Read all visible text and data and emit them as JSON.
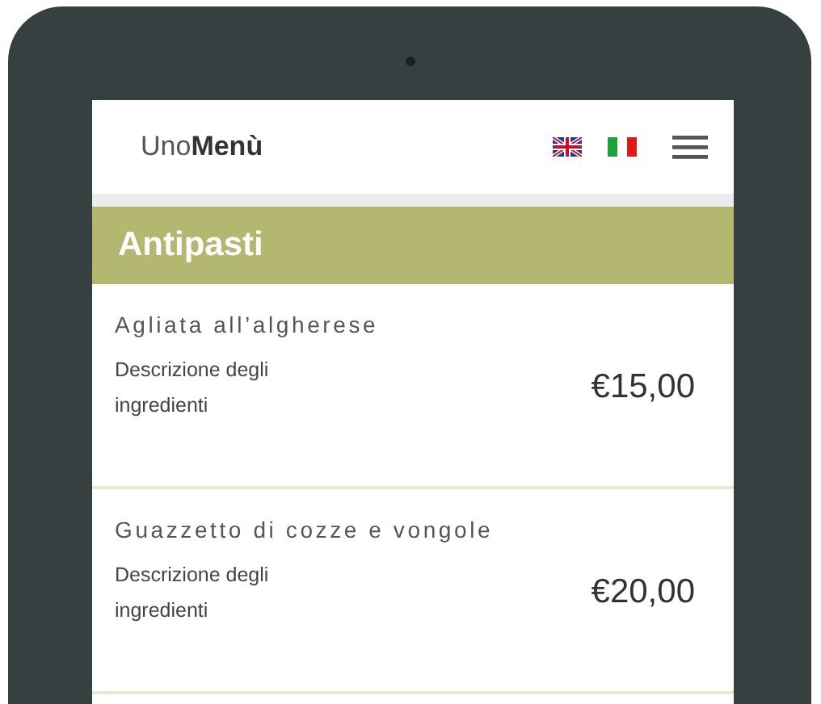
{
  "brand": "Uno**Menù**",
  "languages": [
    {
      "kind": "en"
    },
    {
      "kind": "it"
    }
  ],
  "section": {
    "title": "Antipasti"
  },
  "items": [
    {
      "name": "Agliata all’algherese",
      "description": "Descrizione degli ingredienti",
      "price": "€15,00"
    },
    {
      "name": "Guazzetto di cozze e vongole",
      "description": "Descrizione degli ingredienti",
      "price": "€20,00"
    }
  ]
}
